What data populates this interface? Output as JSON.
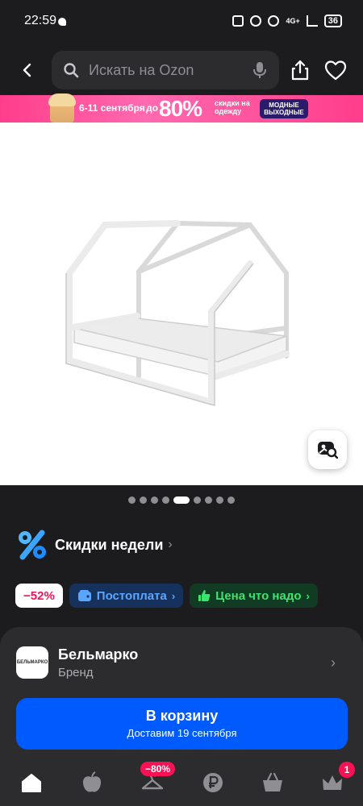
{
  "status_bar": {
    "time": "22:59",
    "network": "4G+",
    "battery": "36"
  },
  "header": {
    "search_placeholder": "Искать на Ozon"
  },
  "banner": {
    "dates": "6-11 сентября",
    "upto": "до",
    "percent": "80%",
    "discount_text": "скидки на одежду",
    "tag_text": "МОДНЫЕ ВЫХОДНЫЕ"
  },
  "gallery": {
    "dot_count": 9,
    "active_dot_index": 4
  },
  "promo": {
    "weekly_label": "Скидки недели",
    "chips": [
      {
        "label": "−52%",
        "style": "red"
      },
      {
        "label": "Постоплата",
        "style": "blue"
      },
      {
        "label": "Цена что надо",
        "style": "green"
      }
    ]
  },
  "seller": {
    "logo_text": "БЕЛЬМАРКО",
    "name": "Бельмарко",
    "type": "Бренд"
  },
  "cart_button": {
    "title": "В корзину",
    "subtitle": "Доставим 19 сентября"
  },
  "tabbar": {
    "items": [
      "home-icon",
      "apple-icon",
      "hanger-icon",
      "ruble-icon",
      "basket-icon",
      "crown-icon"
    ],
    "sale_badge": "−80%",
    "cart_badge": "1"
  },
  "colors": {
    "accent": "#005bff",
    "brand_pink": "#f91155",
    "background": "#1c1c1e"
  }
}
